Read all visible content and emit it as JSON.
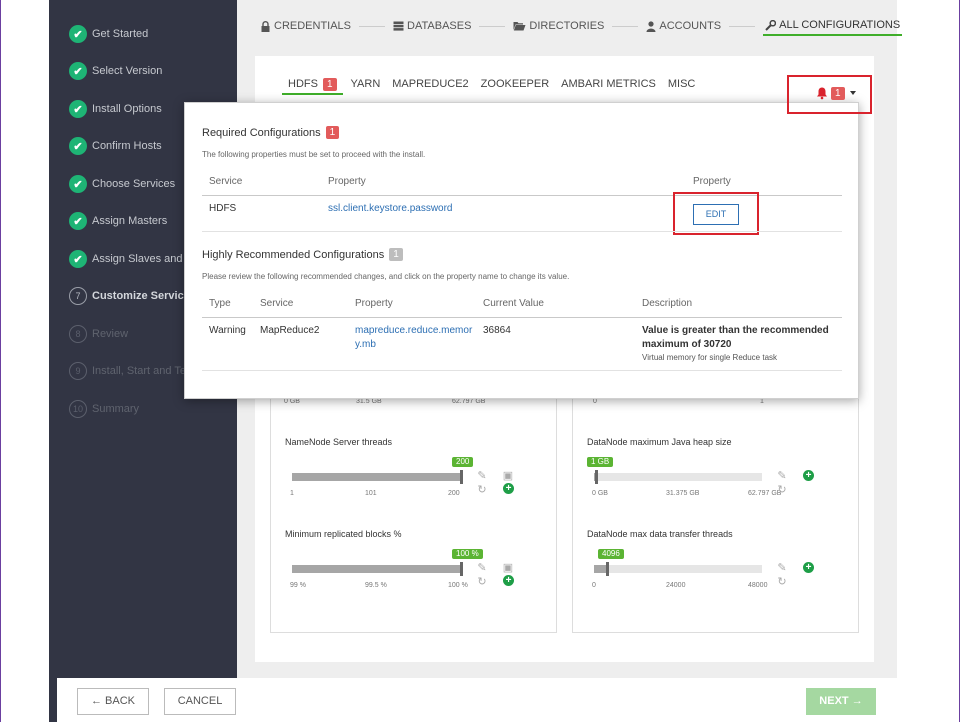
{
  "wizard_steps": [
    {
      "label": "Get Started",
      "state": "done",
      "num": ""
    },
    {
      "label": "Select Version",
      "state": "done",
      "num": ""
    },
    {
      "label": "Install Options",
      "state": "done",
      "num": ""
    },
    {
      "label": "Confirm Hosts",
      "state": "done",
      "num": ""
    },
    {
      "label": "Choose Services",
      "state": "done",
      "num": ""
    },
    {
      "label": "Assign Masters",
      "state": "done",
      "num": ""
    },
    {
      "label": "Assign Slaves and C",
      "state": "done",
      "num": ""
    },
    {
      "label": "Customize Services",
      "state": "current",
      "num": "7"
    },
    {
      "label": "Review",
      "state": "todo",
      "num": "8"
    },
    {
      "label": "Install, Start and Te",
      "state": "todo",
      "num": "9"
    },
    {
      "label": "Summary",
      "state": "todo",
      "num": "10"
    }
  ],
  "topnav": {
    "credentials": "CREDENTIALS",
    "databases": "DATABASES",
    "directories": "DIRECTORIES",
    "accounts": "ACCOUNTS",
    "all_configurations": "ALL CONFIGURATIONS"
  },
  "tabs": {
    "hdfs": "HDFS",
    "hdfs_badge": "1",
    "yarn": "YARN",
    "mapreduce2": "MAPREDUCE2",
    "zookeeper": "ZOOKEEPER",
    "ambari_metrics": "AMBARI METRICS",
    "misc": "MISC"
  },
  "alerts": {
    "count": "1"
  },
  "popover": {
    "required": {
      "title": "Required Configurations",
      "badge": "1",
      "subtitle": "The following properties must be set to proceed with the install.",
      "headers": {
        "service": "Service",
        "property": "Property",
        "action": "Property"
      },
      "row": {
        "service": "HDFS",
        "property": "ssl.client.keystore.password",
        "button": "EDIT"
      }
    },
    "recommended": {
      "title": "Highly Recommended Configurations",
      "badge": "1",
      "subtitle": "Please review the following recommended changes, and click on the property name to change its value.",
      "headers": {
        "type": "Type",
        "service": "Service",
        "property": "Property",
        "current_value": "Current Value",
        "description": "Description"
      },
      "row": {
        "type": "Warning",
        "service": "MapReduce2",
        "property_line1": "mapreduce.reduce.memor",
        "property_line2": "y.mb",
        "current_value": "36864",
        "desc_line1": "Value is greater than the recommended",
        "desc_line2": "maximum of 30720",
        "desc_note": "Virtual memory for single Reduce task"
      }
    }
  },
  "partial_ticks": {
    "left": [
      "0 GB",
      "31.5 GB",
      "62.797 GB"
    ],
    "right": [
      "0",
      "1"
    ]
  },
  "controls": {
    "namenode_threads": {
      "title": "NameNode Server threads",
      "value_label": "200",
      "level": 1.0,
      "ticks": [
        "1",
        "101",
        "200"
      ]
    },
    "min_replicated": {
      "title": "Minimum replicated blocks %",
      "value_label": "100 %",
      "level": 1.0,
      "ticks": [
        "99 %",
        "99.5 %",
        "100 %"
      ]
    },
    "datanode_heap": {
      "title": "DataNode maximum Java heap size",
      "value_label": "1 GB",
      "level": 0.016,
      "ticks": [
        "0 GB",
        "31.375 GB",
        "62.797 GB"
      ]
    },
    "datanode_transfer": {
      "title": "DataNode max data transfer threads",
      "value_label": "4096",
      "level": 0.085,
      "ticks": [
        "0",
        "24000",
        "48000"
      ]
    }
  },
  "footer": {
    "back": "← BACK",
    "cancel": "CANCEL",
    "next": "NEXT →"
  },
  "colors": {
    "accent_green": "#3fae2a",
    "sidebar_bg": "#323544",
    "alert_red": "#d9232d",
    "link_blue": "#2d6fb3"
  }
}
